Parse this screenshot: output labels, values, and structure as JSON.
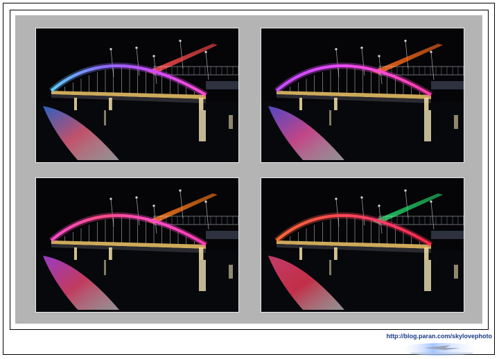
{
  "watermark": {
    "url": "http://blog.paran.com/skylovephoto"
  },
  "photos": [
    {
      "id": "photo-1",
      "arch_colors": [
        "#5fd0ff",
        "#8a6cff",
        "#d04cff",
        "#ff4cd2"
      ],
      "pylon_color": "#ff4a4a",
      "reflection_colors": [
        "#3a7cff",
        "#ff6a8a",
        "#ffffff"
      ]
    },
    {
      "id": "photo-2",
      "arch_colors": [
        "#c84cff",
        "#e24cff",
        "#ff4cd8",
        "#ff3ca8"
      ],
      "pylon_color": "#ff6a1a",
      "reflection_colors": [
        "#6a5cff",
        "#ff5ab0",
        "#ffffff"
      ]
    },
    {
      "id": "photo-3",
      "arch_colors": [
        "#ff4cd2",
        "#ff4c8a",
        "#ff4cc8",
        "#ff3cb0"
      ],
      "pylon_color": "#ff7a1a",
      "reflection_colors": [
        "#c84cff",
        "#ff4c7a",
        "#ffffff"
      ]
    },
    {
      "id": "photo-4",
      "arch_colors": [
        "#ff6a3a",
        "#ff4c4c",
        "#ff3c6a",
        "#ff2a4a"
      ],
      "pylon_color": "#22d46a",
      "reflection_colors": [
        "#ff4c8a",
        "#ff3c5a",
        "#ffffff"
      ]
    }
  ]
}
